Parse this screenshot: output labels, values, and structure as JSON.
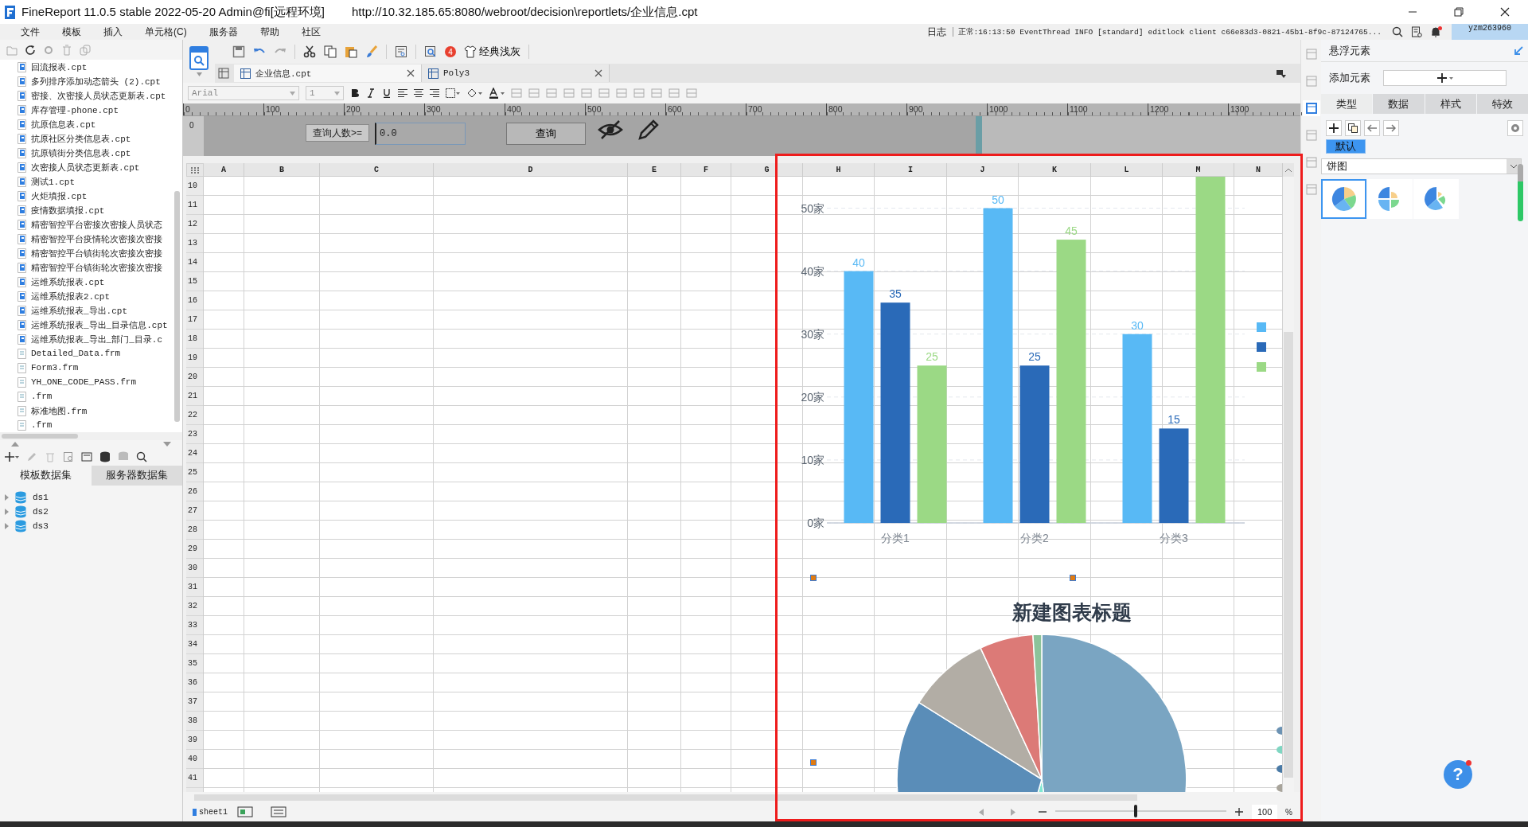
{
  "window": {
    "title": "FineReport 11.0.5 stable 2022-05-20 Admin@fi[远程环境]",
    "url": "http://10.32.185.65:8080/webroot/decision\\reportlets/企业信息.cpt"
  },
  "menu": [
    "文件",
    "模板",
    "插入",
    "单元格(C)",
    "服务器",
    "帮助",
    "社区"
  ],
  "log": {
    "label": "日志",
    "message": "正常:16:13:50 EventThread INFO [standard] editlock client c66e83d3-0821-45b1-8f9c-87124765...",
    "user": "yzm263960"
  },
  "file_tree": [
    {
      "name": "回流报表.cpt",
      "kind": "cpt"
    },
    {
      "name": "多列排序添加动态箭头 (2).cpt",
      "kind": "cpt"
    },
    {
      "name": "密接、次密接人员状态更新表.cpt",
      "kind": "cpt"
    },
    {
      "name": "库存管理-phone.cpt",
      "kind": "cpt"
    },
    {
      "name": "抗原信息表.cpt",
      "kind": "cpt"
    },
    {
      "name": "抗原社区分类信息表.cpt",
      "kind": "cpt"
    },
    {
      "name": "抗原镇街分类信息表.cpt",
      "kind": "cpt"
    },
    {
      "name": "次密接人员状态更新表.cpt",
      "kind": "cpt"
    },
    {
      "name": "测试1.cpt",
      "kind": "cpt"
    },
    {
      "name": "火炬填报.cpt",
      "kind": "cpt"
    },
    {
      "name": "疫情数据填报.cpt",
      "kind": "cpt"
    },
    {
      "name": "精密智控平台密接次密接人员状态",
      "kind": "cpt"
    },
    {
      "name": "精密智控平台疫情轮次密接次密接",
      "kind": "cpt"
    },
    {
      "name": "精密智控平台镇街轮次密接次密接",
      "kind": "cpt"
    },
    {
      "name": "精密智控平台镇街轮次密接次密接",
      "kind": "cpt"
    },
    {
      "name": "运维系统报表.cpt",
      "kind": "cpt"
    },
    {
      "name": "运维系统报表2.cpt",
      "kind": "cpt"
    },
    {
      "name": "运维系统报表_导出.cpt",
      "kind": "cpt"
    },
    {
      "name": "运维系统报表_导出_目录信息.cpt",
      "kind": "cpt"
    },
    {
      "name": "运维系统报表_导出_部门_目录.c",
      "kind": "cpt"
    },
    {
      "name": "Detailed_Data.frm",
      "kind": "frm"
    },
    {
      "name": "Form3.frm",
      "kind": "frm"
    },
    {
      "name": "YH_ONE_CODE_PASS.frm",
      "kind": "frm"
    },
    {
      "name": ".frm",
      "kind": "frm"
    },
    {
      "name": "标准地图.frm",
      "kind": "frm"
    },
    {
      "name": ".frm",
      "kind": "frm"
    }
  ],
  "dataset_tabs": [
    {
      "label": "模板数据集",
      "selected": true
    },
    {
      "label": "服务器数据集",
      "selected": false
    }
  ],
  "datasets": [
    "ds1",
    "ds2",
    "ds3"
  ],
  "toolbar": {
    "badge": "4",
    "theme_label": "经典浅灰"
  },
  "tabs": [
    {
      "label": "企业信息.cpt",
      "selected": true
    },
    {
      "label": "Poly3",
      "selected": false
    }
  ],
  "format_bar": {
    "font": "Arial",
    "size": "1"
  },
  "ruler": {
    "vertical": "0",
    "ticks": [
      "0",
      "100",
      "200",
      "300",
      "400",
      "500",
      "600",
      "700",
      "800",
      "900",
      "1000",
      "1100",
      "1200",
      "1300"
    ]
  },
  "parameters": {
    "label": "查询人数>=",
    "value": "0.0",
    "button": "查询"
  },
  "sheet": {
    "columns": [
      "A",
      "B",
      "C",
      "D",
      "E",
      "F",
      "G",
      "H",
      "I",
      "J",
      "K",
      "L",
      "M",
      "N"
    ],
    "rows": [
      "10",
      "11",
      "12",
      "13",
      "14",
      "15",
      "16",
      "17",
      "18",
      "19",
      "20",
      "21",
      "22",
      "23",
      "24",
      "25",
      "26",
      "27",
      "28",
      "29",
      "30",
      "31",
      "32",
      "33",
      "34",
      "35",
      "36",
      "37",
      "38",
      "39",
      "40",
      "41"
    ]
  },
  "bar_chart": {
    "chart_data": {
      "type": "bar",
      "categories": [
        "分类1",
        "分类2",
        "分类3"
      ],
      "series": [
        {
          "color": "#58b9f5",
          "values": [
            40,
            50,
            30
          ]
        },
        {
          "color": "#2a6ab8",
          "values": [
            35,
            25,
            15
          ]
        },
        {
          "color": "#9bd985",
          "values": [
            25,
            45,
            55
          ]
        }
      ],
      "ylim": [
        0,
        55
      ],
      "yticks": [
        {
          "value": 0,
          "label": "0家"
        },
        {
          "value": 10,
          "label": "10家"
        },
        {
          "value": 20,
          "label": "20家"
        },
        {
          "value": 30,
          "label": "30家"
        },
        {
          "value": 40,
          "label": "40家"
        },
        {
          "value": 50,
          "label": "50家"
        }
      ],
      "grid": true,
      "value_labels": [
        [
          "40",
          "50",
          "30"
        ],
        [
          "35",
          "25",
          "15"
        ],
        [
          "25",
          "45",
          null
        ]
      ]
    }
  },
  "pie_chart": {
    "title": "新建图表标题"
  },
  "sheet_tabs": [
    {
      "label": "sheet1",
      "selected": true
    }
  ],
  "zoom": {
    "level": 0.47,
    "value": "100",
    "unit": "%"
  },
  "side_icons": [
    {
      "selected": false
    },
    {
      "selected": false
    },
    {
      "selected": true
    },
    {
      "selected": false
    },
    {
      "selected": false
    },
    {
      "selected": false
    }
  ],
  "float_panel": {
    "title": "悬浮元素",
    "add_label": "添加元素",
    "tabs": [
      {
        "label": "类型",
        "selected": true
      },
      {
        "label": "数据",
        "selected": false
      },
      {
        "label": "样式",
        "selected": false
      },
      {
        "label": "特效",
        "selected": false
      }
    ],
    "style_button": "默认",
    "chart_type": "饼图",
    "variants": [
      {
        "selected": true
      },
      {
        "selected": false
      },
      {
        "selected": false
      }
    ]
  },
  "help": "?"
}
